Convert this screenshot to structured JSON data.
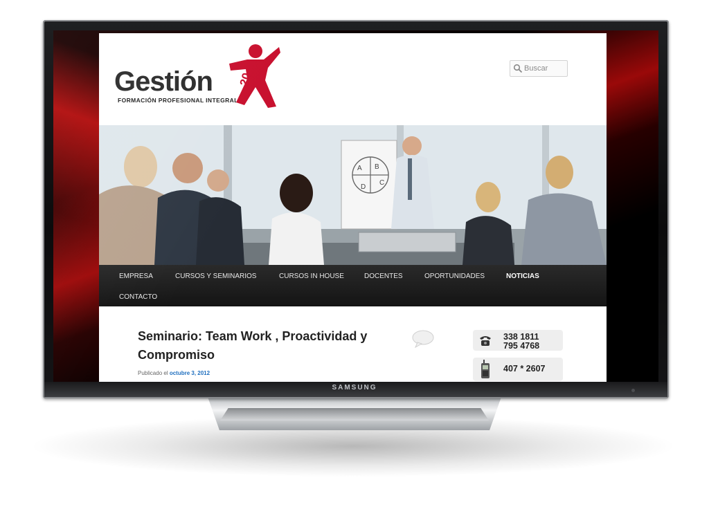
{
  "device": {
    "brand": "SAMSUNG"
  },
  "site": {
    "logo": {
      "name": "Gestión",
      "badge": "20",
      "tagline": "FORMACIÓN PROFESIONAL INTEGRAL"
    },
    "search": {
      "placeholder": "Buscar"
    },
    "nav": {
      "items": [
        {
          "label": "EMPRESA"
        },
        {
          "label": "CURSOS Y SEMINARIOS"
        },
        {
          "label": "CURSOS IN HOUSE"
        },
        {
          "label": "DOCENTES"
        },
        {
          "label": "OPORTUNIDADES"
        },
        {
          "label": "NOTICIAS",
          "active": true
        },
        {
          "label": "CONTACTO"
        }
      ]
    },
    "hero": {
      "flipchart_labels": [
        "A",
        "B",
        "C",
        "D"
      ]
    },
    "post": {
      "title": "Seminario: Team Work , Proactividad y Compromiso",
      "meta_prefix": "Publicado el",
      "date": "octubre 3, 2012"
    },
    "contacts": [
      {
        "icon": "telephone-icon",
        "lines": [
          "338 1811",
          "795 4768"
        ]
      },
      {
        "icon": "mobile-phone-icon",
        "lines": [
          "407 * 2607"
        ]
      }
    ]
  },
  "colors": {
    "accent_red": "#c8102e",
    "link_blue": "#1f6fbf",
    "nav_bg": "#1c1c1c"
  }
}
